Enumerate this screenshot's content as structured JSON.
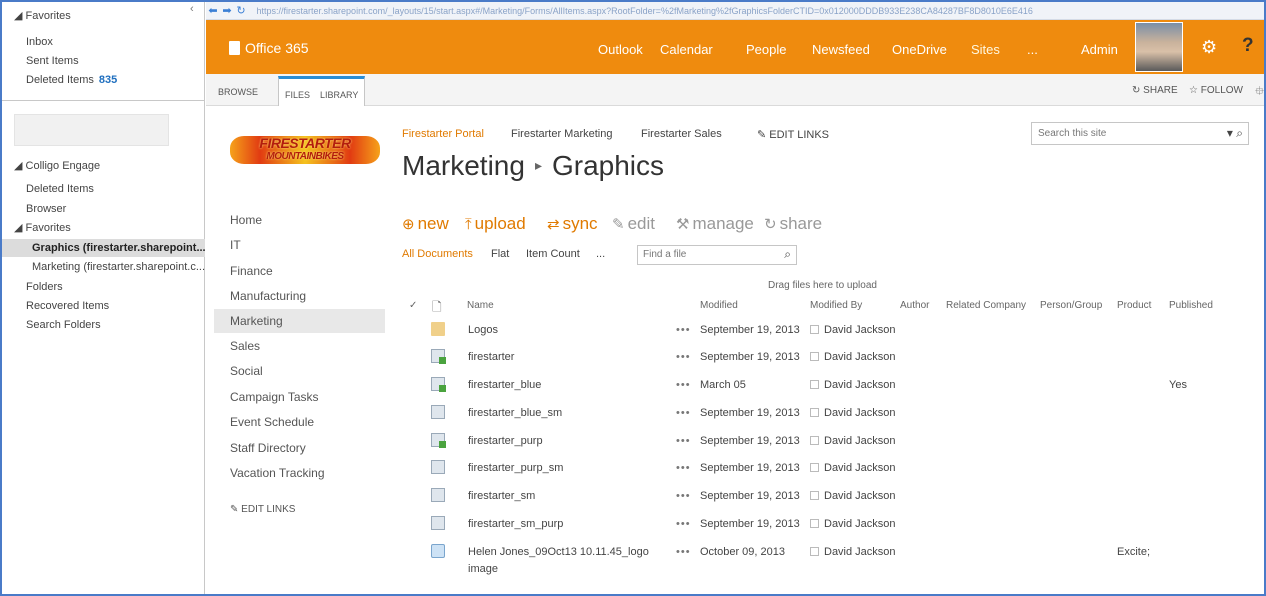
{
  "outlook": {
    "favorites_header": "Favorites",
    "inbox": "Inbox",
    "sent": "Sent Items",
    "deleted": "Deleted Items",
    "deleted_count": "835",
    "engage_header": "Colligo Engage",
    "engage_items": [
      "Deleted Items",
      "Browser"
    ],
    "engage_favorites": "Favorites",
    "graphics_fav": "Graphics (firestarter.sharepoint....",
    "marketing_fav": "Marketing (firestarter.sharepoint.c...",
    "more_items": [
      "Folders",
      "Recovered Items",
      "Search Folders"
    ]
  },
  "browser": {
    "url": "https://firestarter.sharepoint.com/_layouts/15/start.aspx#/Marketing/Forms/AllItems.aspx?RootFolder=%2fMarketing%2fGraphicsFolderCTID=0x012000DDDB933E238CA84287BF8D8010E6E416"
  },
  "suite": {
    "brand": "Office 365",
    "nav": [
      "Outlook",
      "Calendar",
      "People",
      "Newsfeed",
      "OneDrive",
      "Sites",
      "...",
      "Admin"
    ],
    "help": "?"
  },
  "ribbon": {
    "tabs": [
      "BROWSE",
      "FILES",
      "LIBRARY"
    ],
    "share": "SHARE",
    "follow": "FOLLOW"
  },
  "site": {
    "logo_line1": "FIRESTARTER",
    "logo_line2": "MOUNTAINBIKES",
    "topnav": [
      "Firestarter Portal",
      "Firestarter Marketing",
      "Firestarter Sales"
    ],
    "edit_links": "EDIT LINKS",
    "title_part1": "Marketing",
    "title_sep": "▸",
    "title_part2": "Graphics",
    "search_placeholder": "Search this site"
  },
  "quicklaunch": [
    "Home",
    "IT",
    "Finance",
    "Manufacturing",
    "Marketing",
    "Sales",
    "Social",
    "Campaign Tasks",
    "Event Schedule",
    "Staff Directory",
    "Vacation Tracking"
  ],
  "quicklaunch_edit": "EDIT LINKS",
  "commands": {
    "new": "new",
    "upload": "upload",
    "sync": "sync",
    "edit": "edit",
    "manage": "manage",
    "share": "share"
  },
  "views": {
    "all": "All Documents",
    "flat": "Flat",
    "count": "Item Count",
    "more": "...",
    "find_placeholder": "Find a file",
    "drag_text": "Drag files here to upload"
  },
  "columns": [
    "Name",
    "Modified",
    "Modified By",
    "Author",
    "Related Company",
    "Person/Group",
    "Product",
    "Published"
  ],
  "rows": [
    {
      "name": "Logos",
      "modified": "September 19, 2013",
      "by": "David Jackson",
      "icon": "folder-icon",
      "product": "",
      "published": ""
    },
    {
      "name": "firestarter",
      "modified": "September 19, 2013",
      "by": "David Jackson",
      "icon": "image-new-icon",
      "product": "",
      "published": ""
    },
    {
      "name": "firestarter_blue",
      "modified": "March 05",
      "by": "David Jackson",
      "icon": "image-new-icon",
      "product": "",
      "published": "Yes"
    },
    {
      "name": "firestarter_blue_sm",
      "modified": "September 19, 2013",
      "by": "David Jackson",
      "icon": "image-icon",
      "product": "",
      "published": ""
    },
    {
      "name": "firestarter_purp",
      "modified": "September 19, 2013",
      "by": "David Jackson",
      "icon": "image-new-icon",
      "product": "",
      "published": ""
    },
    {
      "name": "firestarter_purp_sm",
      "modified": "September 19, 2013",
      "by": "David Jackson",
      "icon": "image-icon",
      "product": "",
      "published": ""
    },
    {
      "name": "firestarter_sm",
      "modified": "September 19, 2013",
      "by": "David Jackson",
      "icon": "image-icon",
      "product": "",
      "published": ""
    },
    {
      "name": "firestarter_sm_purp",
      "modified": "September 19, 2013",
      "by": "David Jackson",
      "icon": "image-icon",
      "product": "",
      "published": ""
    },
    {
      "name": "Helen Jones_09Oct13 10.11.45_logo",
      "name2": "image",
      "modified": "October 09, 2013",
      "by": "David Jackson",
      "icon": "email-icon",
      "product": "Excite;",
      "published": ""
    }
  ],
  "colors": {
    "suite_bar": "#ef8b0e",
    "accent": "#e07a00",
    "frame": "#4a7bc8"
  }
}
